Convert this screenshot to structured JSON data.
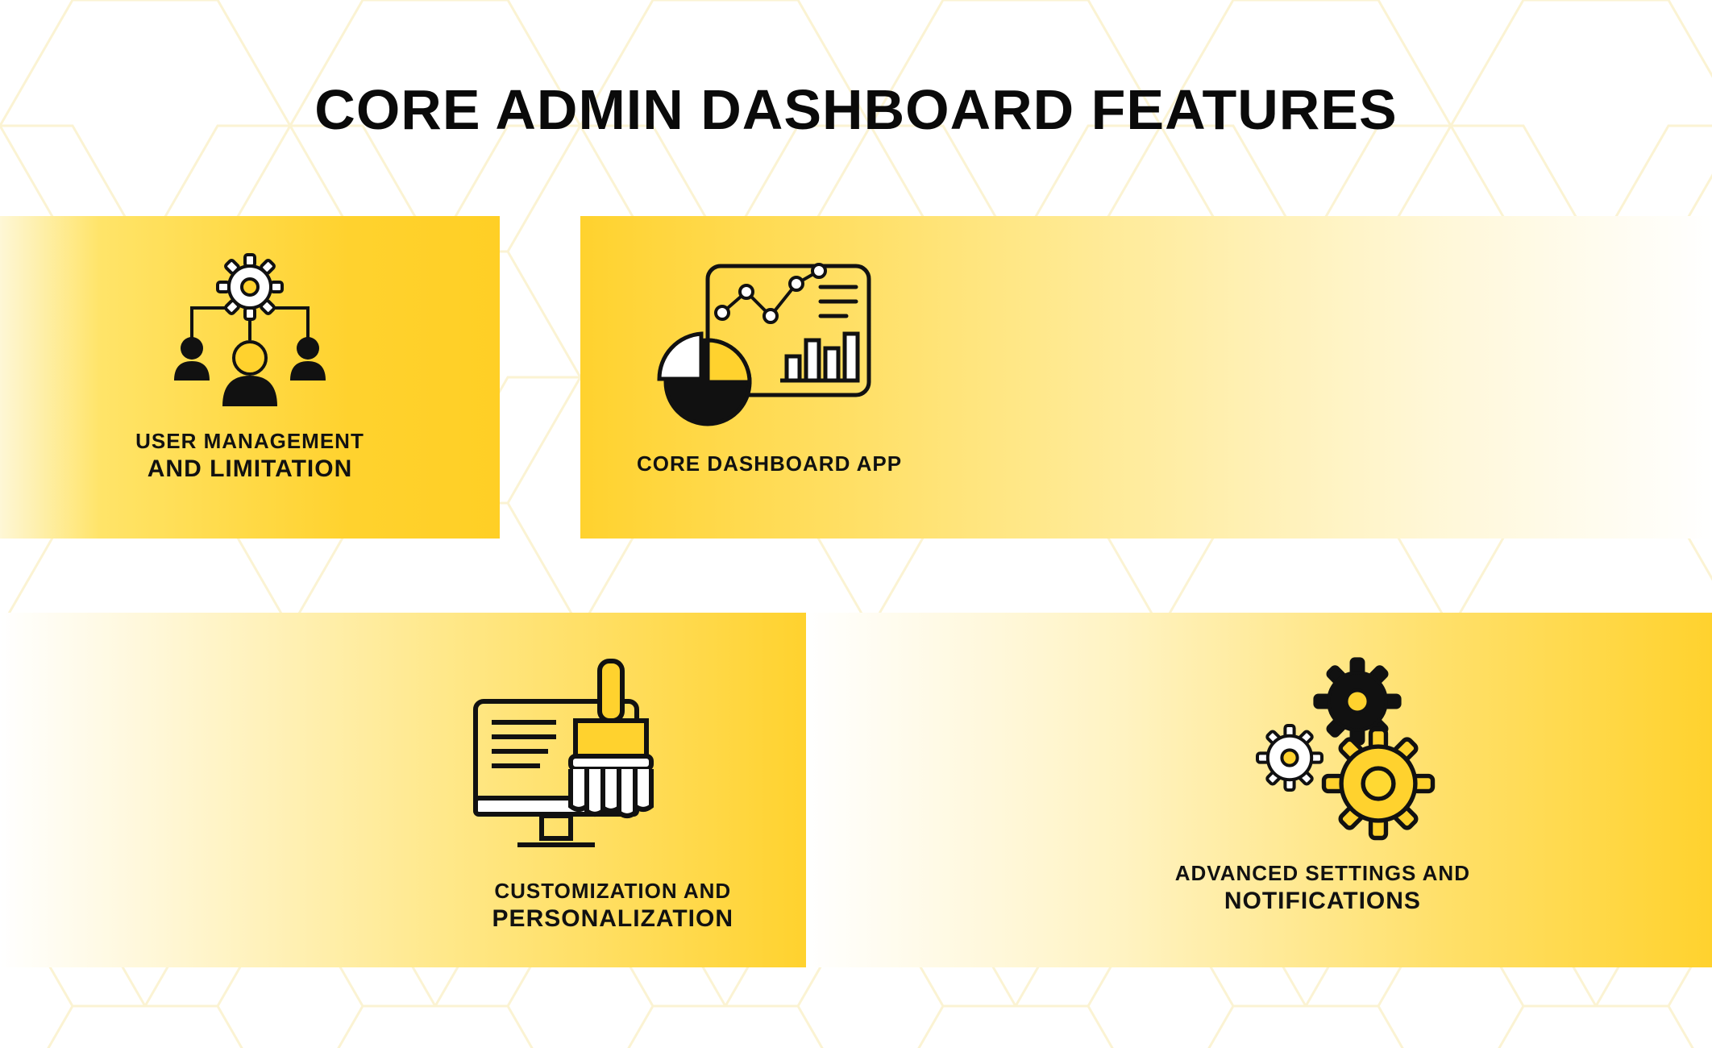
{
  "title": "CORE ADMIN DASHBOARD FEATURES",
  "cards": {
    "user_mgmt": {
      "line1": "USER MANAGEMENT",
      "line2": "AND LIMITATION",
      "icon": "users-gear-icon"
    },
    "core_dashboard": {
      "label": "CORE DASHBOARD APP",
      "icon": "dashboard-analytics-icon"
    },
    "customization": {
      "line1": "CUSTOMIZATION AND",
      "line2": "PERSONALIZATION",
      "icon": "monitor-brush-icon"
    },
    "advanced": {
      "line1": "ADVANCED SETTINGS AND",
      "line2": "NOTIFICATIONS",
      "icon": "gears-icon"
    }
  },
  "colors": {
    "accent": "#ffd22e",
    "text": "#0a0a0a",
    "bg": "#ffffff"
  }
}
